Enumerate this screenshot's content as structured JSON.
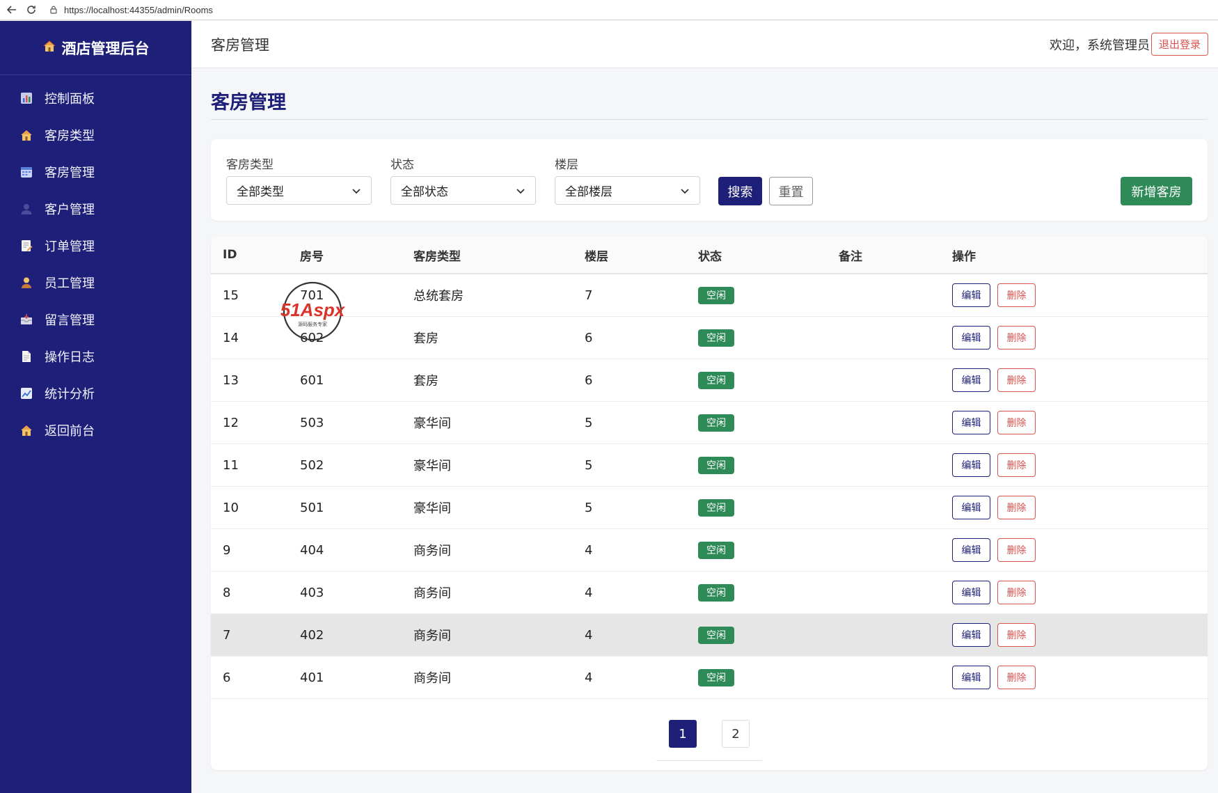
{
  "browser": {
    "url": "https://localhost:44355/admin/Rooms"
  },
  "sidebar": {
    "brand": "酒店管理后台",
    "items": [
      {
        "label": "控制面板",
        "icon": "bar-chart-icon"
      },
      {
        "label": "客房类型",
        "icon": "house-icon"
      },
      {
        "label": "客房管理",
        "icon": "calendar-icon"
      },
      {
        "label": "客户管理",
        "icon": "person-icon"
      },
      {
        "label": "订单管理",
        "icon": "memo-icon"
      },
      {
        "label": "员工管理",
        "icon": "staff-icon"
      },
      {
        "label": "留言管理",
        "icon": "inbox-icon"
      },
      {
        "label": "操作日志",
        "icon": "document-icon"
      },
      {
        "label": "统计分析",
        "icon": "line-chart-icon"
      },
      {
        "label": "返回前台",
        "icon": "house-icon"
      }
    ]
  },
  "header": {
    "title": "客房管理",
    "welcome": "欢迎，系统管理员",
    "logout_label": "退出登录"
  },
  "page": {
    "title": "客房管理"
  },
  "filters": {
    "type_label": "客房类型",
    "type_value": "全部类型",
    "status_label": "状态",
    "status_value": "全部状态",
    "floor_label": "楼层",
    "floor_value": "全部楼层",
    "search_label": "搜索",
    "reset_label": "重置",
    "add_label": "新增客房"
  },
  "table": {
    "headers": [
      "ID",
      "房号",
      "客房类型",
      "楼层",
      "状态",
      "备注",
      "操作"
    ],
    "edit_label": "编辑",
    "delete_label": "删除",
    "rows": [
      {
        "id": "15",
        "room_no": "701",
        "type": "总统套房",
        "floor": "7",
        "status": "空闲",
        "note": ""
      },
      {
        "id": "14",
        "room_no": "602",
        "type": "套房",
        "floor": "6",
        "status": "空闲",
        "note": ""
      },
      {
        "id": "13",
        "room_no": "601",
        "type": "套房",
        "floor": "6",
        "status": "空闲",
        "note": ""
      },
      {
        "id": "12",
        "room_no": "503",
        "type": "豪华间",
        "floor": "5",
        "status": "空闲",
        "note": ""
      },
      {
        "id": "11",
        "room_no": "502",
        "type": "豪华间",
        "floor": "5",
        "status": "空闲",
        "note": ""
      },
      {
        "id": "10",
        "room_no": "501",
        "type": "豪华间",
        "floor": "5",
        "status": "空闲",
        "note": ""
      },
      {
        "id": "9",
        "room_no": "404",
        "type": "商务间",
        "floor": "4",
        "status": "空闲",
        "note": ""
      },
      {
        "id": "8",
        "room_no": "403",
        "type": "商务间",
        "floor": "4",
        "status": "空闲",
        "note": ""
      },
      {
        "id": "7",
        "room_no": "402",
        "type": "商务间",
        "floor": "4",
        "status": "空闲",
        "note": ""
      },
      {
        "id": "6",
        "room_no": "401",
        "type": "商务间",
        "floor": "4",
        "status": "空闲",
        "note": ""
      }
    ]
  },
  "pagination": {
    "pages": [
      "1",
      "2"
    ],
    "current": "1"
  },
  "watermark": {
    "text": "51Aspx",
    "subtext": "源码服务专家"
  },
  "colors": {
    "sidebar": "#1e1f78",
    "primary": "#1e1f78",
    "success": "#2e8b57",
    "danger": "#d9534f"
  }
}
